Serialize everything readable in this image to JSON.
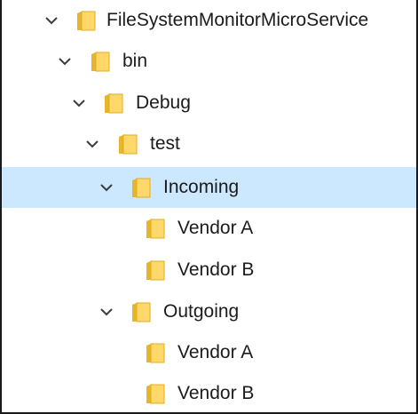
{
  "tree": {
    "nodes": [
      {
        "label": "FileSystemMonitorMicroService",
        "expanded": true,
        "selected": false,
        "icon": "folder-icon"
      },
      {
        "label": "bin",
        "expanded": true,
        "selected": false,
        "icon": "folder-icon"
      },
      {
        "label": "Debug",
        "expanded": true,
        "selected": false,
        "icon": "folder-icon"
      },
      {
        "label": "test",
        "expanded": true,
        "selected": false,
        "icon": "folder-icon"
      },
      {
        "label": "Incoming",
        "expanded": true,
        "selected": true,
        "icon": "folder-icon"
      },
      {
        "label": "Vendor A",
        "expanded": false,
        "selected": false,
        "icon": "folder-icon"
      },
      {
        "label": "Vendor B",
        "expanded": false,
        "selected": false,
        "icon": "folder-icon"
      },
      {
        "label": "Outgoing",
        "expanded": true,
        "selected": false,
        "icon": "folder-icon"
      },
      {
        "label": "Vendor A",
        "expanded": false,
        "selected": false,
        "icon": "folder-icon"
      },
      {
        "label": "Vendor B",
        "expanded": false,
        "selected": false,
        "icon": "folder-icon"
      }
    ]
  },
  "colors": {
    "selection": "#cce8ff",
    "folder_front": "#ffd86b",
    "folder_back": "#e8b428",
    "chevron": "#3c3c3c",
    "text": "#1b1b1b"
  }
}
